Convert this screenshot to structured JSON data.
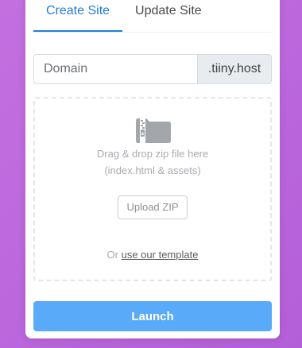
{
  "tabs": [
    {
      "label": "Create Site",
      "active": true
    },
    {
      "label": "Update Site",
      "active": false
    }
  ],
  "domain": {
    "placeholder": "Domain",
    "value": "",
    "suffix": ".tiiny.host"
  },
  "dropzone": {
    "icon": "zip-folder-icon",
    "line1": "Drag & drop zip file here",
    "line2": "(index.html & assets)",
    "upload_label": "Upload ZIP",
    "template_prefix": "Or ",
    "template_link": "use our template"
  },
  "launch_label": "Launch",
  "colors": {
    "accent": "#1d7de0",
    "launch": "#5aaafa",
    "background": "#c46fe0",
    "icon": "#a3a7ab"
  }
}
